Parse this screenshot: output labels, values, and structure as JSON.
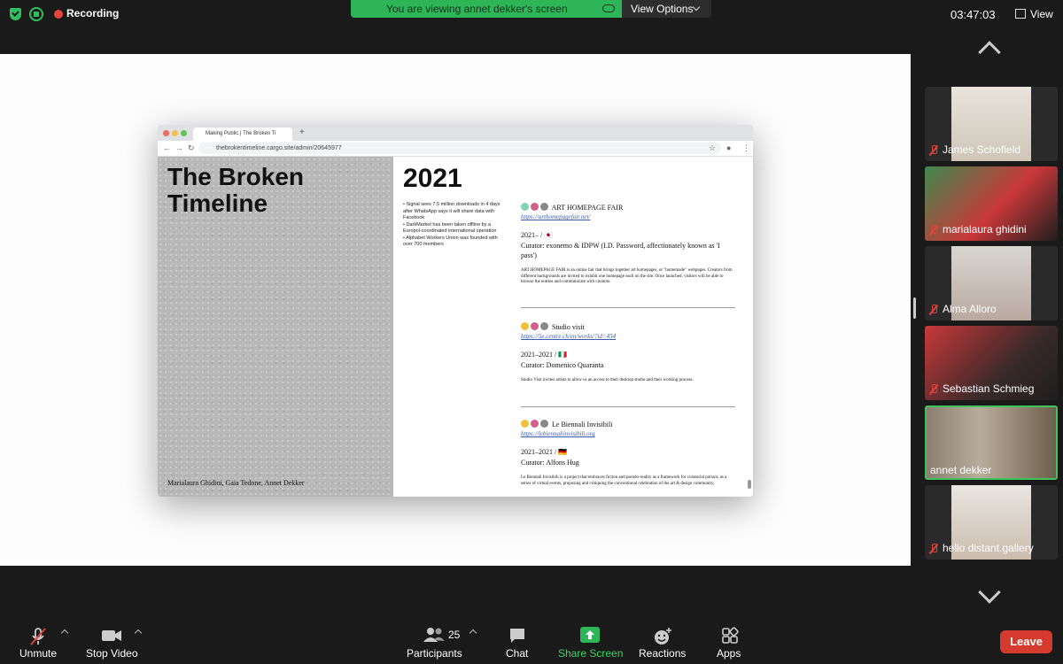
{
  "topbar": {
    "recording_label": "Recording",
    "banner_text": "You are viewing annet dekker's screen",
    "view_options_label": "View Options",
    "clock": "03:47:03",
    "view_label": "View"
  },
  "browser": {
    "tab_title": "Making Public | The Broken Ti",
    "new_tab": "+",
    "url": "thebrokentimeline.cargo.site/admin/20645977"
  },
  "site": {
    "title_line1": "The Broken",
    "title_line2": "Timeline",
    "authors": "Marialaura Ghidini, Gaia Tedone, Annet Dekker",
    "year": "2021",
    "news": [
      "• Signal sees 7.5 million downloads in 4 days after WhatsApp says it will share data with Facebook",
      "• DarkMarket has been taken offline by a Europol-coordinated international operation",
      "• Alphabet Workers Union was founded with over 700 members"
    ],
    "entries": [
      {
        "title": "ART HOMEPAGE FAIR",
        "link": "https://arthomepagefair.net/",
        "dates": "2021– / 🇯🇵",
        "curator": "Curator: exonemo & IDPW (I.D. Password, affectionately known as 'I pass')",
        "description": "ART HOMEPAGE FAIR is an online fair that brings together art homepages, or \"homemade\" webpages. Creators from different backgrounds are invited to exhibit one homepage each on the site. Once launched, visitors will be able to browse the entries and communicate with creators."
      },
      {
        "title": "Studio visit",
        "link": "https://5e.centre.ch/en/works/?id=454",
        "dates": "2021–2021 / 🇮🇹",
        "curator": "Curator: Domenico Quaranta",
        "description": "Studio Visit invites artists to allow us an access to their desktop studio and their working process."
      },
      {
        "title": "Le Biennali Invisibili",
        "link": "https://lebiennaliinvisibili.org",
        "dates": "2021–2021 / 🇩🇪",
        "curator": "Curator: Alfons Hug",
        "description": "Le Biennali Invisibili is a project that embraces fiction and pseudo-reality as a framework for curatorial pursuit, as a series of virtual events, proposing and critiquing the conventional celebration of the art & design community."
      }
    ]
  },
  "participants": [
    {
      "name": "James Schofield"
    },
    {
      "name": "marialaura ghidini"
    },
    {
      "name": "Alma Alloro"
    },
    {
      "name": "Sebastian Schmieg"
    },
    {
      "name": "annet dekker"
    },
    {
      "name": "hello distant.gallery"
    }
  ],
  "toolbar": {
    "unmute": "Unmute",
    "stop_video": "Stop Video",
    "participants": "Participants",
    "participant_count": "25",
    "chat": "Chat",
    "share_screen": "Share Screen",
    "reactions": "Reactions",
    "apps": "Apps",
    "leave": "Leave"
  },
  "colors": {
    "banner_green": "#2db557",
    "leave_red": "#d53a2e",
    "active_speaker_border": "#3fc35b",
    "muted_red": "#e5433a"
  }
}
